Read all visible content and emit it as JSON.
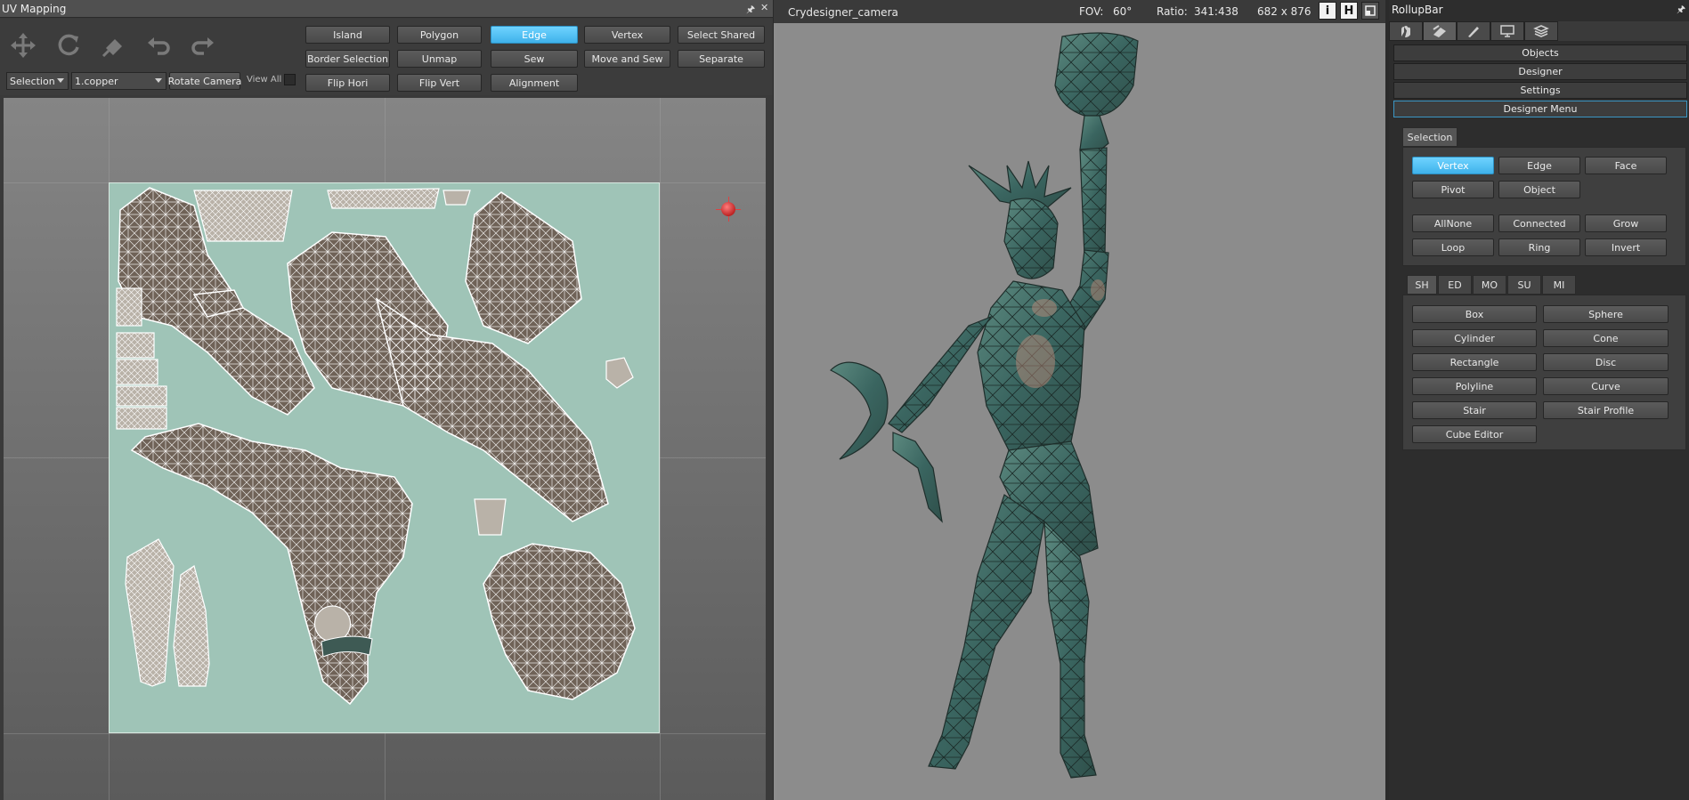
{
  "uv_panel": {
    "title": "UV Mapping",
    "pin": "⚐",
    "tools": [
      "move-icon",
      "rotate-icon",
      "scale-icon",
      "undo-icon",
      "redo-icon"
    ],
    "selection_combo": "Selection",
    "material_combo": "1.copper",
    "rotate_camera": "Rotate Camera",
    "view_all": "View All",
    "buttons": {
      "island": "Island",
      "polygon": "Polygon",
      "edge": "Edge",
      "vertex": "Vertex",
      "select_shared": "Select Shared",
      "border_selection": "Border Selection",
      "unmap": "Unmap",
      "sew": "Sew",
      "move_and_sew": "Move and Sew",
      "separate": "Separate",
      "flip_hori": "Flip Hori",
      "flip_vert": "Flip Vert",
      "alignment": "Alignment"
    }
  },
  "camera": {
    "name": "Crydesigner_camera",
    "fov_label": "FOV:",
    "fov_value": "60°",
    "ratio_label": "Ratio:",
    "ratio_value": "341:438",
    "resolution": "682 x 876",
    "btn_i": "i",
    "btn_h": "H"
  },
  "rollup": {
    "title": "RollupBar",
    "pin": "⚐",
    "sections": [
      "Objects",
      "Designer",
      "Settings",
      "Designer Menu"
    ],
    "selection_tab": "Selection",
    "selection_buttons": [
      [
        "Vertex",
        "Edge",
        "Face"
      ],
      [
        "Pivot",
        "Object"
      ],
      [
        "AllNone",
        "Connected",
        "Grow"
      ],
      [
        "Loop",
        "Ring",
        "Invert"
      ]
    ],
    "shape_tabs": [
      "SH",
      "ED",
      "MO",
      "SU",
      "MI"
    ],
    "shape_buttons": [
      [
        "Box",
        "Sphere"
      ],
      [
        "Cylinder",
        "Cone"
      ],
      [
        "Rectangle",
        "Disc"
      ],
      [
        "Polyline",
        "Curve"
      ],
      [
        "Stair",
        "Stair Profile"
      ],
      [
        "Cube Editor"
      ]
    ]
  },
  "colors": {
    "active_button": "#4fc3f7",
    "texture_bg": "#9fc4b7",
    "statue": "#3f6e66"
  }
}
